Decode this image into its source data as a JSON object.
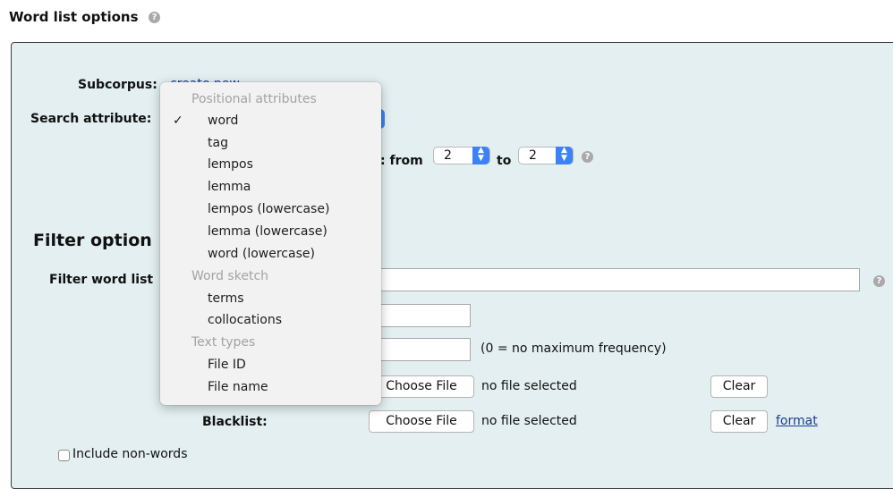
{
  "header": {
    "title": "Word list options"
  },
  "subcorpus": {
    "label": "Subcorpus:",
    "link": "create new"
  },
  "search_attribute": {
    "label": "Search attribute:"
  },
  "ngram": {
    "from_label": ": from",
    "from_value": "2",
    "to_label": "to",
    "to_value": "2"
  },
  "filter": {
    "heading": "Filter option",
    "filter_label": "Filter word list",
    "max_freq_note": "(0 = no maximum frequency)",
    "whitelist": {
      "choose_label": "Choose File",
      "status": "no file selected",
      "clear_label": "Clear"
    },
    "blacklist": {
      "label": "Blacklist:",
      "choose_label": "Choose File",
      "status": "no file selected",
      "clear_label": "Clear",
      "format_link": "format"
    },
    "include_nonwords": {
      "label": "Include non-words",
      "checked": false
    }
  },
  "dropdown": {
    "selected": "word",
    "groups": [
      {
        "header": "Positional attributes",
        "items": [
          "word",
          "tag",
          "lempos",
          "lemma",
          "lempos (lowercase)",
          "lemma (lowercase)",
          "word (lowercase)"
        ]
      },
      {
        "header": "Word sketch",
        "items": [
          "terms",
          "collocations"
        ]
      },
      {
        "header": "Text types",
        "items": [
          "File ID",
          "File name"
        ]
      }
    ]
  },
  "icons": {
    "help": "help-icon",
    "check": "checkmark-icon",
    "stepper": "up-down-arrows-icon"
  },
  "colors": {
    "panel_bg": "#e3eff0",
    "accent": "#3b82f6",
    "link": "#1a3c8f"
  }
}
